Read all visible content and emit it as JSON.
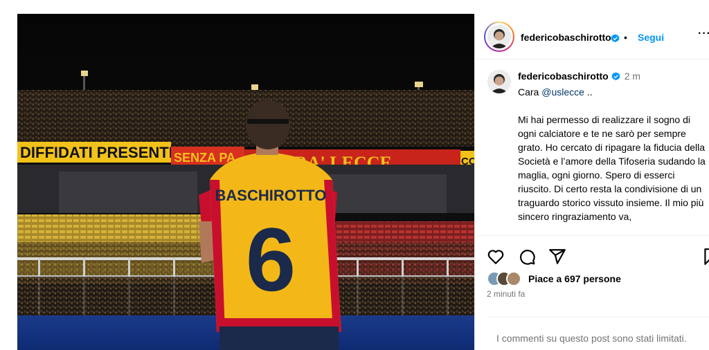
{
  "post": {
    "username": "federicobaschirotto",
    "follow_label": "Segui",
    "separator": "•",
    "more_label": "···",
    "time_ago": "2 m",
    "caption": {
      "line0_prefix": "Cara ",
      "mention": "@uslecce",
      "line0_suffix": " ..",
      "body": "Mi hai permesso di realizzare il sogno di ogni calciatore e te ne sarò per sempre grato. Ho cercato di ripagare la fiducia della Società e l’amore della Tifoseria sudando la maglia, ogni giorno. Spero di esserci riuscito. Di certo resta la condivisione di un traguardo storico vissuto insieme. Il mio più sincero ringraziamento va,"
    },
    "likes_text": "Piace a 697 persone",
    "posted": "2 minuti fa",
    "comments_limited": "I commenti su questo post sono stati limitati."
  },
  "photo": {
    "banner_left": "DIFFIDATI PRESENTI",
    "banner_middle": "SENZA PA",
    "banner_right": "RA' LECCE",
    "banner_far_right": "CO",
    "jersey_name": "BASCHIROTTO",
    "jersey_number": "6"
  },
  "icons": {
    "verified": "verified-badge-icon",
    "like": "heart-icon",
    "comment": "comment-icon",
    "share": "send-icon",
    "save": "bookmark-icon"
  },
  "colors": {
    "follow": "#0095f6",
    "verified": "#0095f6",
    "muted": "#737373",
    "mention": "#00376b",
    "jersey_yellow": "#f3b818",
    "jersey_red": "#c8102e"
  }
}
